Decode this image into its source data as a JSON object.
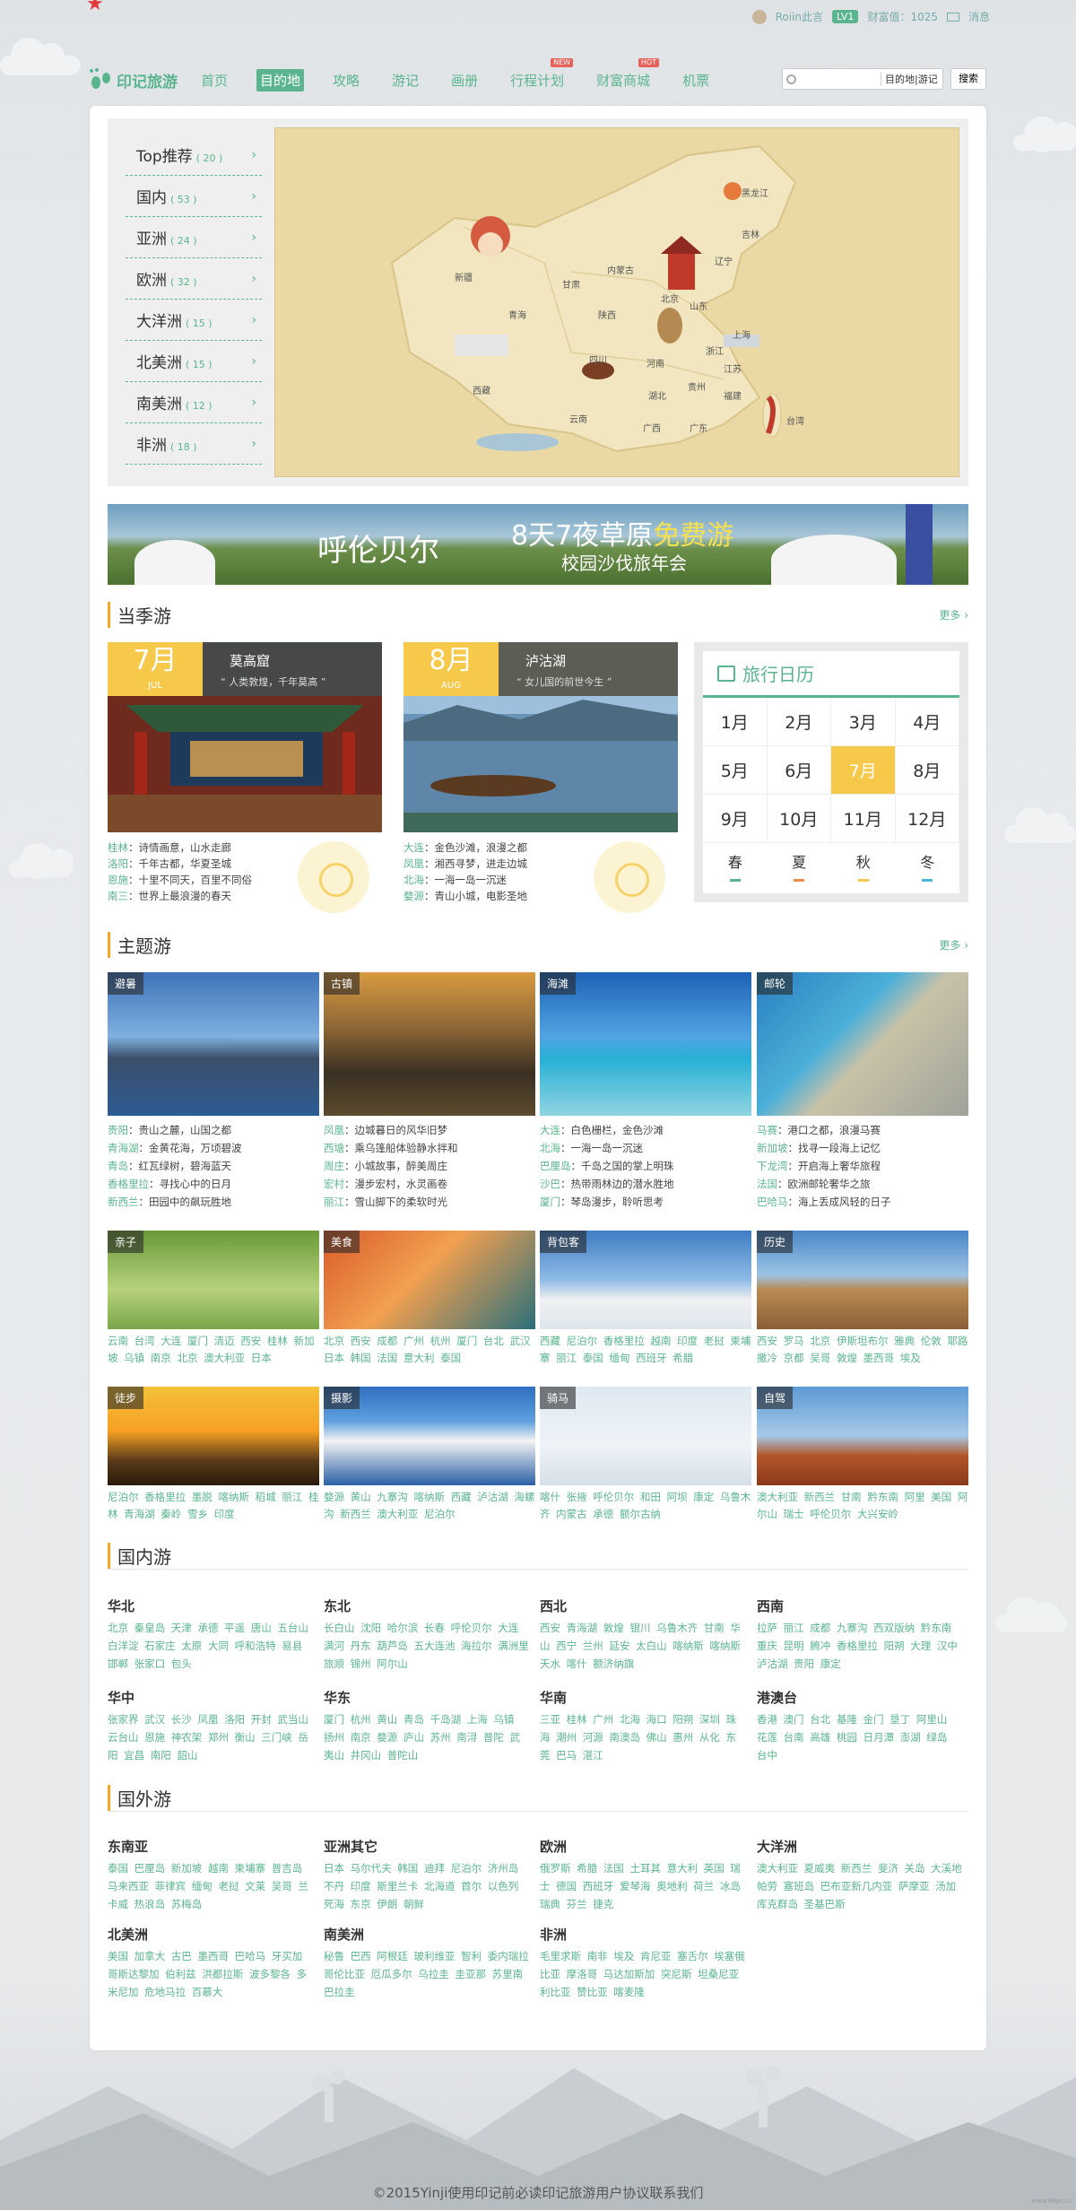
{
  "user": {
    "name": "Roiin此言",
    "level": "LV1",
    "wealth": "财富值：1025",
    "messages": "消息"
  },
  "nav": {
    "logo": "印记旅游",
    "items": [
      {
        "label": "首页",
        "tag": ""
      },
      {
        "label": "目的地",
        "tag": ""
      },
      {
        "label": "攻略",
        "tag": ""
      },
      {
        "label": "游记",
        "tag": ""
      },
      {
        "label": "画册",
        "tag": ""
      },
      {
        "label": "行程计划",
        "tag": "NEW"
      },
      {
        "label": "财富商城",
        "tag": "HOT"
      },
      {
        "label": "机票",
        "tag": ""
      }
    ],
    "search_scope": "目的地|游记",
    "search_button": "搜索"
  },
  "destinations": [
    {
      "label": "Top推荐",
      "count": "( 20 )"
    },
    {
      "label": "国内",
      "count": "( 53 )"
    },
    {
      "label": "亚洲",
      "count": "( 24 )"
    },
    {
      "label": "欧洲",
      "count": "( 32 )"
    },
    {
      "label": "大洋洲",
      "count": "( 15 )"
    },
    {
      "label": "北美洲",
      "count": "( 15 )"
    },
    {
      "label": "南美洲",
      "count": "( 12 )"
    },
    {
      "label": "非洲",
      "count": "( 18 )"
    }
  ],
  "map_labels": {
    "heilongjiang": "黑龙江",
    "jilin": "吉林",
    "liaoning": "辽宁",
    "neimenggu": "内蒙古",
    "xinjiang": "新疆",
    "gansu": "甘肃",
    "qinghai": "青海",
    "beijing": "北京",
    "shandong": "山东",
    "shaanxi": "陕西",
    "xizang": "西藏",
    "sichuan": "四川",
    "henan": "河南",
    "shanghai": "上海",
    "zhejiang": "浙江",
    "hubei": "湖北",
    "guizhou": "贵州",
    "jiangxi": "江苏",
    "fujian": "福建",
    "yunnan": "云南",
    "guangxi": "广西",
    "guangdong": "广东",
    "taiwan": "台湾"
  },
  "banner": {
    "place": "呼伦贝尔",
    "headline_a": "8天7夜草原",
    "headline_b": "免费游",
    "sub": "校园沙伐旅年会"
  },
  "season": {
    "title": "当季游",
    "more": "更多",
    "cards": [
      {
        "month": "7月",
        "month_en": "JUL",
        "name": "莫高窟",
        "quote": "“ 人类敦煌，千年莫高 ”",
        "lines": [
          {
            "k": "桂林",
            "v": "：诗情画意，山水走廊"
          },
          {
            "k": "洛阳",
            "v": "：千年古都，华夏圣城"
          },
          {
            "k": "恩施",
            "v": "：十里不同天，百里不同俗"
          },
          {
            "k": "南三",
            "v": "：世界上最浪漫的春天"
          }
        ]
      },
      {
        "month": "8月",
        "month_en": "AUG",
        "name": "泸沽湖",
        "quote": "“ 女儿国的前世今生 ”",
        "lines": [
          {
            "k": "大连",
            "v": "：金色沙滩，浪漫之都"
          },
          {
            "k": "凤凰",
            "v": "：湘西寻梦，进走边城"
          },
          {
            "k": "北海",
            "v": "：一海一岛一沉迷"
          },
          {
            "k": "婺源",
            "v": "：青山小城，电影圣地"
          }
        ]
      }
    ],
    "calendar": {
      "title": "旅行日历",
      "months": [
        "1月",
        "2月",
        "3月",
        "4月",
        "5月",
        "6月",
        "7月",
        "8月",
        "9月",
        "10月",
        "11月",
        "12月"
      ],
      "selected": "7月",
      "seasons": [
        "春",
        "夏",
        "秋",
        "冬"
      ],
      "season_colors": [
        "#5ab58f",
        "#f08a4b",
        "#f6c94b",
        "#4bb8d9"
      ]
    }
  },
  "themes": {
    "title": "主题游",
    "more": "更多",
    "large": [
      {
        "label": "避暑",
        "lines": [
          {
            "k": "贵阳",
            "v": "：贵山之麓，山国之都"
          },
          {
            "k": "青海湖",
            "v": "：金黄花海，万顷碧波"
          },
          {
            "k": "青岛",
            "v": "：红瓦绿树，碧海蓝天"
          },
          {
            "k": "香格里拉",
            "v": "：寻找心中的日月"
          },
          {
            "k": "新西兰",
            "v": "：田园中的飙玩胜地"
          }
        ]
      },
      {
        "label": "古镇",
        "lines": [
          {
            "k": "凤凰",
            "v": "：边城暮日的风华旧梦"
          },
          {
            "k": "西塘",
            "v": "：乘乌篷船体验静水拌和"
          },
          {
            "k": "周庄",
            "v": "：小城故事，醉美周庄"
          },
          {
            "k": "宏村",
            "v": "：漫步宏村，水灵画卷"
          },
          {
            "k": "丽江",
            "v": "：雪山脚下的柔软时光"
          }
        ]
      },
      {
        "label": "海滩",
        "lines": [
          {
            "k": "大连",
            "v": "：白色栅栏，金色沙滩"
          },
          {
            "k": "北海",
            "v": "：一海一岛一沉迷"
          },
          {
            "k": "巴厘岛",
            "v": "：千岛之国的掌上明珠"
          },
          {
            "k": "沙巴",
            "v": "：热带雨林边的潜水胜地"
          },
          {
            "k": "厦门",
            "v": "：琴岛漫步，聆听思考"
          }
        ]
      },
      {
        "label": "邮轮",
        "lines": [
          {
            "k": "马赛",
            "v": "：港口之都，浪漫马赛"
          },
          {
            "k": "新加坡",
            "v": "：找寻一段海上记忆"
          },
          {
            "k": "下龙湾",
            "v": "：开启海上奢华旅程"
          },
          {
            "k": "法国",
            "v": "：欧洲邮轮奢华之旅"
          },
          {
            "k": "巴哈马",
            "v": "：海上丢成风轻的日子"
          }
        ]
      }
    ],
    "small": [
      {
        "label": "亲子",
        "tags": "云南 台湾 大连 厦门 清迈 西安 桂林 新加坡 乌镇 南京 北京 澳大利亚 日本"
      },
      {
        "label": "美食",
        "tags": "北京 西安 成都 广州 杭州 厦门 台北 武汉 日本 韩国 法国 意大利 泰国"
      },
      {
        "label": "背包客",
        "tags": "西藏 尼泊尔 香格里拉 越南 印度 老挝 柬埔寨 丽江 泰国 缅甸 西班牙 希腊"
      },
      {
        "label": "历史",
        "tags": "西安 罗马 北京 伊斯坦布尔 雅典 伦敦 耶路撒冷 京都 吴哥 敦煌 墨西哥 埃及"
      },
      {
        "label": "徒步",
        "tags": "尼泊尔 香格里拉 墨脱 喀纳斯 稻城 丽江 桂林 青海湖 秦岭 雪乡 印度"
      },
      {
        "label": "摄影",
        "tags": "婺源 黄山 九寨沟 喀纳斯 西藏 泸沽湖 海螺沟 新西兰 澳大利亚 尼泊尔"
      },
      {
        "label": "骑马",
        "tags": "喀什 张掖 呼伦贝尔 和田 阿坝 康定 乌鲁木齐 内蒙古 承德 额尔古纳"
      },
      {
        "label": "自驾",
        "tags": "澳大利亚 新西兰 甘南 黔东南 阿里 美国 阿尔山 瑞士 呼伦贝尔 大兴安岭"
      }
    ]
  },
  "domestic": {
    "title": "国内游",
    "regions": [
      {
        "name": "华北",
        "places": "北京 秦皇岛 天津 承德 平遥 唐山 五台山 白洋淀 石家庄 太原 大同 呼和浩特 易县 邯郸 张家口 包头"
      },
      {
        "name": "东北",
        "places": "长白山 沈阳 哈尔滨 长春 呼伦贝尔 大连 满河 丹东 葫芦岛 五大连池 海拉尔 满洲里 旅顺 锦州 阿尔山"
      },
      {
        "name": "西北",
        "places": "西安 青海湖 敦煌 银川 乌鲁木齐 甘南 华山 西宁 兰州 延安 太白山 喀纳斯 喀纳斯 天水 喀什 额济纳旗"
      },
      {
        "name": "西南",
        "places": "拉萨 丽江 成都 九寨沟 西双版纳 黔东南 重庆 昆明 腾冲 香格里拉 阳朔 大理 汉中 泸沽湖 贵阳 康定"
      },
      {
        "name": "华中",
        "places": "张家界 武汉 长沙 凤凰 洛阳 开封 武当山 云台山 恩施 神农架 郑州 衡山 三门峡 岳阳 宜昌 南阳 韶山"
      },
      {
        "name": "华东",
        "places": "厦门 杭州 黄山 青岛 千岛湖 上海 乌镇 扬州 南京 婺源 庐山 苏州 南浔 普陀 武夷山 井冈山 普陀山"
      },
      {
        "name": "华南",
        "places": "三亚 桂林 广州 北海 海口 阳朔 深圳 珠海 潮州 河源 南澳岛 佛山 惠州 从化 东莞 巴马 湛江"
      },
      {
        "name": "港澳台",
        "places": "香港 澳门 台北 基隆 金门 垦丁 阿里山 花莲 台南 高雄 桃园 日月潭 澎湖 绿岛 台中"
      }
    ]
  },
  "overseas": {
    "title": "国外游",
    "regions": [
      {
        "name": "东南亚",
        "places": "泰国 巴厘岛 新加坡 越南 柬埔寨 普吉岛 马来西亚 菲律宾 缅甸 老挝 文莱 吴哥 兰卡威 热浪岛 苏梅岛"
      },
      {
        "name": "亚洲其它",
        "places": "日本 马尔代夫 韩国 迪拜 尼泊尔 济州岛 不丹 印度 斯里兰卡 北海道 首尔 以色列 死海 东京 伊朗 朝鲜"
      },
      {
        "name": "欧洲",
        "places": "俄罗斯 希腊 法国 土耳其 意大利 英国 瑞士 德国 西班牙 爱琴海 奥地利 荷兰 冰岛 瑞典 芬兰 捷克"
      },
      {
        "name": "大洋洲",
        "places": "澳大利亚 夏威夷 新西兰 斐济 关岛 大溪地 帕劳 塞班岛 巴布亚新几内亚 萨摩亚 汤加 库克群岛 圣基巴斯"
      },
      {
        "name": "北美洲",
        "places": "美国 加拿大 古巴 墨西哥 巴哈马 牙买加 哥斯达黎加 伯利兹 洪都拉斯 波多黎各 多米尼加 危地马拉 百慕大"
      },
      {
        "name": "南美洲",
        "places": "秘鲁 巴西 阿根廷 玻利维亚 智利 委内瑞拉 哥伦比亚 厄瓜多尔 乌拉圭 圭亚那 苏里南 巴拉圭"
      },
      {
        "name": "非洲",
        "places": "毛里求斯 南非 埃及 肯尼亚 塞舌尔 埃塞俄比亚 摩洛哥 马达加斯加 突尼斯 坦桑尼亚 利比亚 赞比亚 喀麦隆"
      }
    ]
  },
  "footer": {
    "text": "©2015Yinji使用印记前必读印记旅游用户协议联系我们",
    "watermark": "www.86ps.cc"
  }
}
